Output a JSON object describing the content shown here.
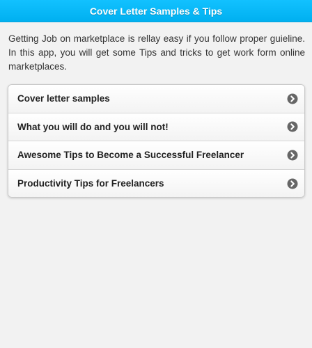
{
  "header": {
    "title": "Cover Letter Samples & Tips"
  },
  "intro": {
    "text": "Getting Job on marketplace is rellay easy if you follow proper guieline. In this app, you will get some Tips and tricks to get work form online marketplaces."
  },
  "menu": {
    "items": [
      {
        "label": "Cover letter samples",
        "icon": "chevron-right-circle-icon"
      },
      {
        "label": "What you will do and you will not!",
        "icon": "chevron-right-circle-icon"
      },
      {
        "label": "Awesome Tips to Become a Successful Freelancer",
        "icon": "chevron-right-circle-icon"
      },
      {
        "label": "Productivity Tips for Freelancers",
        "icon": "chevron-right-circle-icon"
      }
    ]
  },
  "colors": {
    "header_bg": "#00b0f0",
    "page_bg": "#f2f2f2",
    "icon_gray": "#666666"
  }
}
